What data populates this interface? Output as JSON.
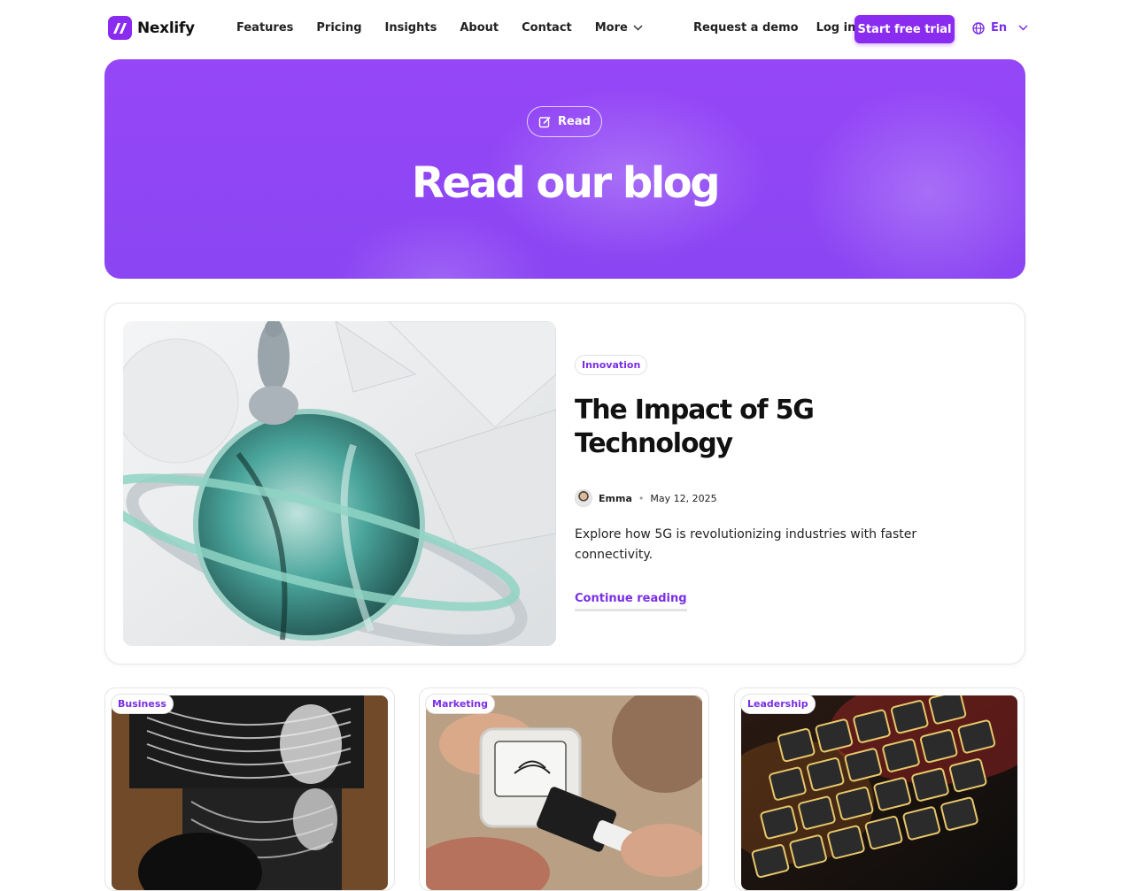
{
  "brand": {
    "name": "Nexlify",
    "accent": "#8a2cf0"
  },
  "nav": {
    "items": [
      {
        "label": "Features"
      },
      {
        "label": "Pricing"
      },
      {
        "label": "Insights"
      },
      {
        "label": "About"
      },
      {
        "label": "Contact"
      },
      {
        "label": "More",
        "icon": "chevron-down-icon"
      }
    ],
    "request_demo": "Request a demo",
    "login": "Log in",
    "cta": "Start free trial",
    "language": "En"
  },
  "hero": {
    "badge": "Read",
    "badge_icon": "edit-icon",
    "title": "Read our blog"
  },
  "featured": {
    "tag": "Innovation",
    "title": "The Impact of 5G Technology",
    "author": "Emma",
    "date": "May 12, 2025",
    "excerpt": "Explore how 5G is revolutionizing industries with faster connectivity.",
    "cta": "Continue reading"
  },
  "cards": [
    {
      "tag": "Business"
    },
    {
      "tag": "Marketing"
    },
    {
      "tag": "Leadership"
    }
  ]
}
